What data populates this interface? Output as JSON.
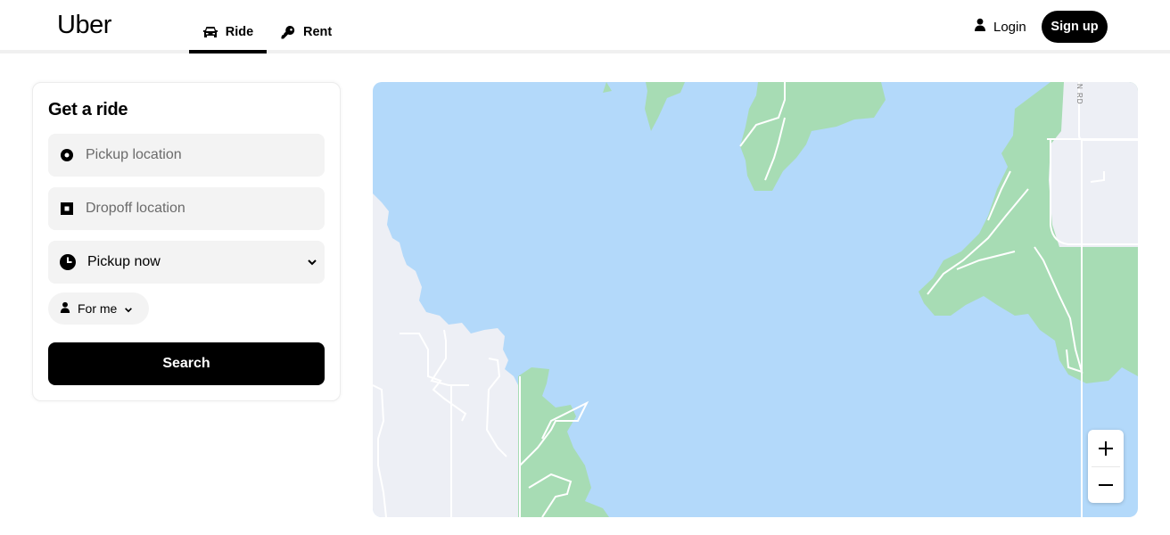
{
  "header": {
    "logo": "Uber",
    "tabs": [
      {
        "label": "Ride",
        "icon": "car-icon",
        "active": true
      },
      {
        "label": "Rent",
        "icon": "key-icon",
        "active": false
      }
    ],
    "login_label": "Login",
    "signup_label": "Sign up"
  },
  "ride_card": {
    "title": "Get a ride",
    "pickup": {
      "placeholder": "Pickup location",
      "value": ""
    },
    "dropoff": {
      "placeholder": "Dropoff location",
      "value": ""
    },
    "time_select": {
      "selected": "Pickup now"
    },
    "rider_select": {
      "selected": "For me"
    },
    "search_label": "Search"
  },
  "map": {
    "road_label": "N RD",
    "zoom_in_symbol": "+",
    "zoom_out_symbol": "−",
    "colors": {
      "water": "#b3d9fa",
      "park": "#a7dcb4",
      "land": "#edeff5",
      "road": "#ffffff"
    }
  },
  "colors": {
    "accent": "#000000",
    "field_bg": "#f3f3f3"
  }
}
